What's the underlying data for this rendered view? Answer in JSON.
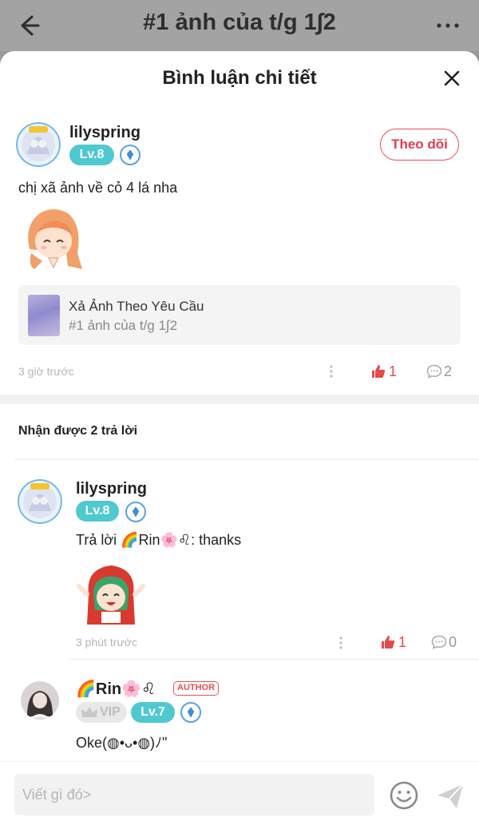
{
  "topbar": {
    "title": "#1 ảnh của t/g 1∫2"
  },
  "sheet": {
    "title": "Bình luận chi tiết"
  },
  "comment": {
    "username": "lilyspring",
    "level": "Lv.8",
    "follow_label": "Theo dõi",
    "text": "chị xã ảnh về cỏ 4 lá nha",
    "link": {
      "title": "Xả Ảnh Theo Yêu Cầu",
      "subtitle": "#1 ảnh của t/g 1∫2"
    },
    "time": "3 giờ trước",
    "likes": "1",
    "comments": "2"
  },
  "replies_header": "Nhận được 2 trả lời",
  "replies": [
    {
      "username": "lilyspring",
      "level": "Lv.8",
      "text": "Trả lời 🌈Rin🌸♌: thanks",
      "time": "3 phút trước",
      "likes": "1",
      "comments": "0"
    },
    {
      "username": "🌈Rin🌸♌",
      "author_tag": "AUTHOR",
      "vip": "VIP",
      "level": "Lv.7",
      "text": "Oke(◍•ᴗ•◍)ﾉ\""
    }
  ],
  "input": {
    "placeholder": "Viết gì đó>"
  },
  "colors": {
    "accent_red": "#e83a4c",
    "level_teal": "#4fc9cf",
    "like_red": "#e64a4a"
  }
}
